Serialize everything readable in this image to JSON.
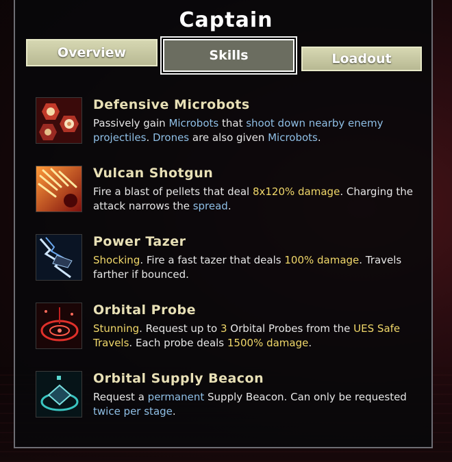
{
  "title": "Captain",
  "tabs": [
    {
      "label": "Overview",
      "active": false
    },
    {
      "label": "Skills",
      "active": true
    },
    {
      "label": "Loadout",
      "active": false
    }
  ],
  "skills": [
    {
      "name": "Defensive Microbots",
      "icon": "microbots-icon",
      "description": [
        {
          "text": "Passively gain ",
          "style": "plain"
        },
        {
          "text": "Microbots",
          "style": "blue"
        },
        {
          "text": " that ",
          "style": "plain"
        },
        {
          "text": "shoot down nearby enemy projectiles",
          "style": "blue"
        },
        {
          "text": ". ",
          "style": "plain"
        },
        {
          "text": "Drones",
          "style": "blue"
        },
        {
          "text": " are also given ",
          "style": "plain"
        },
        {
          "text": "Microbots",
          "style": "blue"
        },
        {
          "text": ".",
          "style": "plain"
        }
      ]
    },
    {
      "name": "Vulcan Shotgun",
      "icon": "shotgun-icon",
      "description": [
        {
          "text": "Fire a blast of pellets that deal ",
          "style": "plain"
        },
        {
          "text": "8x120% damage",
          "style": "yellow"
        },
        {
          "text": ". Charging the attack narrows the ",
          "style": "plain"
        },
        {
          "text": "spread",
          "style": "blue"
        },
        {
          "text": ".",
          "style": "plain"
        }
      ]
    },
    {
      "name": "Power Tazer",
      "icon": "tazer-icon",
      "description": [
        {
          "text": "Shocking",
          "style": "yellow"
        },
        {
          "text": ". Fire a fast tazer that deals ",
          "style": "plain"
        },
        {
          "text": "100% damage",
          "style": "yellow"
        },
        {
          "text": ". Travels farther if bounced.",
          "style": "plain"
        }
      ]
    },
    {
      "name": "Orbital Probe",
      "icon": "orbital-probe-icon",
      "description": [
        {
          "text": "Stunning",
          "style": "yellow"
        },
        {
          "text": ". Request up to ",
          "style": "plain"
        },
        {
          "text": "3",
          "style": "yellow"
        },
        {
          "text": " Orbital Probes from the ",
          "style": "plain"
        },
        {
          "text": "UES Safe Travels",
          "style": "yellow"
        },
        {
          "text": ". Each probe deals ",
          "style": "plain"
        },
        {
          "text": "1500% damage",
          "style": "yellow"
        },
        {
          "text": ".",
          "style": "plain"
        }
      ]
    },
    {
      "name": "Orbital Supply Beacon",
      "icon": "supply-beacon-icon",
      "description": [
        {
          "text": "Request a ",
          "style": "plain"
        },
        {
          "text": "permanent",
          "style": "blue"
        },
        {
          "text": " Supply Beacon. Can only be requested ",
          "style": "plain"
        },
        {
          "text": "twice per stage",
          "style": "blue"
        },
        {
          "text": ".",
          "style": "plain"
        }
      ]
    }
  ]
}
